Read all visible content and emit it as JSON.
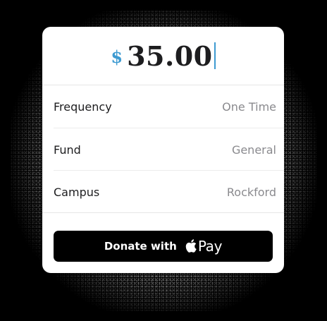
{
  "donation": {
    "currency_symbol": "$",
    "amount": "35.00"
  },
  "fields": [
    {
      "label": "Frequency",
      "value": "One Time"
    },
    {
      "label": "Fund",
      "value": "General"
    },
    {
      "label": "Campus",
      "value": "Rockford"
    }
  ],
  "pay_button": {
    "label": "Donate with",
    "brand": "Pay",
    "icon": "apple-logo-icon"
  },
  "colors": {
    "accent": "#3d9ad1",
    "card_background": "#ffffff",
    "button_background": "#000000",
    "label_text": "#1d1d1f",
    "value_text": "#8a8a8e"
  }
}
